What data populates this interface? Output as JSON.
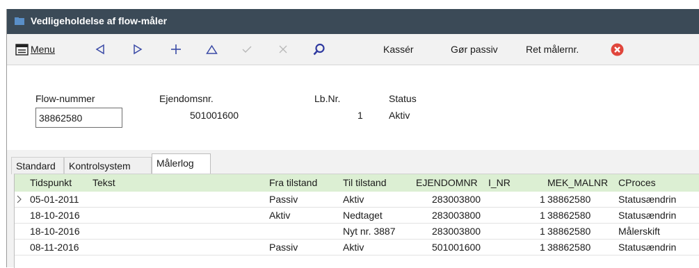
{
  "window": {
    "title": "Vedligeholdelse af flow-måler"
  },
  "toolbar": {
    "menu_label": "Menu",
    "kasser_label": "Kassér",
    "gor_passiv_label": "Gør passiv",
    "ret_malernr_label": "Ret målernr."
  },
  "form": {
    "flow_label": "Flow-nummer",
    "flow_value": "38862580",
    "ejendom_label": "Ejendomsnr.",
    "ejendom_value": "501001600",
    "lbnr_label": "Lb.Nr.",
    "lbnr_value": "1",
    "status_label": "Status",
    "status_value": "Aktiv"
  },
  "tabs": [
    "Standard",
    "Kontrolsystem",
    "Målerlog"
  ],
  "grid": {
    "columns": [
      "Tidspunkt",
      "Tekst",
      "Fra tilstand",
      "Til tilstand",
      "EJENDOMNR",
      "I_NR",
      "MEK_MALNR",
      "CProces"
    ],
    "rows": [
      [
        "05-01-2011",
        "",
        "Passiv",
        "Aktiv",
        "283003800",
        "1",
        "38862580",
        "Statusændrin"
      ],
      [
        "18-10-2016",
        "",
        "Aktiv",
        "Nedtaget",
        "283003800",
        "1",
        "38862580",
        "Statusændrin"
      ],
      [
        "18-10-2016",
        "",
        "",
        "Nyt nr. 3887",
        "283003800",
        "1",
        "38862580",
        "Målerskift"
      ],
      [
        "08-11-2016",
        "",
        "Passiv",
        "Aktiv",
        "501001600",
        "1",
        "38862580",
        "Statusændrin"
      ]
    ]
  },
  "colors": {
    "titlebar": "#3b4a57",
    "header_green": "#dcefd3",
    "close_red": "#e0463c",
    "icon_blue": "#3a4aa6"
  }
}
